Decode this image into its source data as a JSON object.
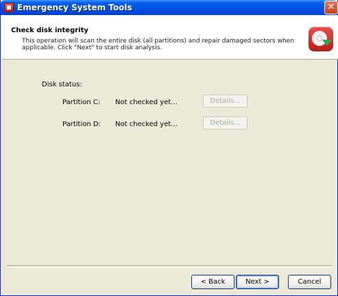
{
  "window": {
    "title": "Emergency System Tools",
    "close_glyph": "✕"
  },
  "header": {
    "title": "Check disk integrity",
    "description": "This operation will scan the entire disk (all partitions) and repair damaged sectors when applicable. Click \"Next\" to start disk analysis.",
    "icon": "disk-repair-icon"
  },
  "disk_status": {
    "label": "Disk status:",
    "partitions": [
      {
        "name": "Partition C:",
        "status": "Not checked yet...",
        "details_label": "Details..."
      },
      {
        "name": "Partition D:",
        "status": "Not checked yet...",
        "details_label": "Details..."
      }
    ]
  },
  "buttons": {
    "back": "< Back",
    "next": "Next >",
    "cancel": "Cancel"
  },
  "colors": {
    "titlebar": "#0055e5",
    "dialog_bg": "#ece9d8",
    "header_bg": "#ffffff",
    "close_button": "#c5401d"
  }
}
